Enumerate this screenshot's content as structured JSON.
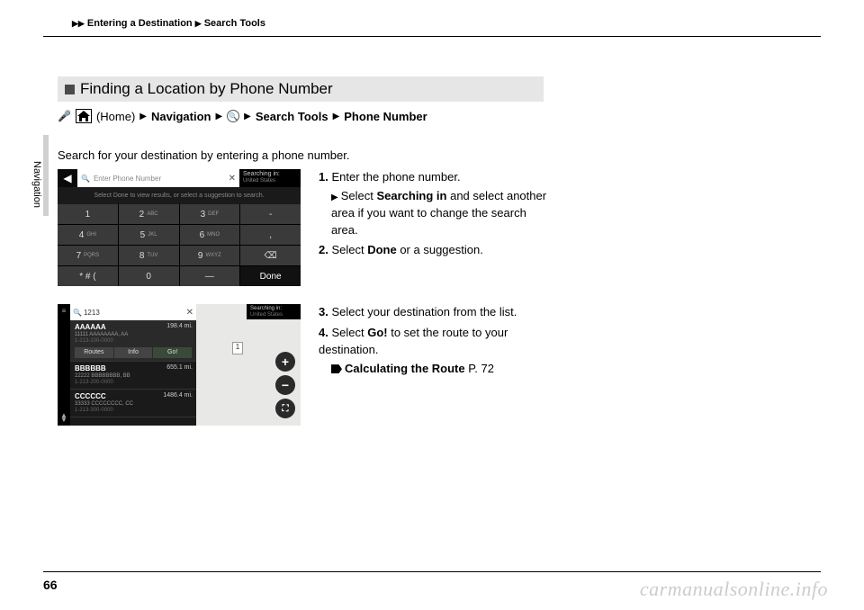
{
  "header": {
    "crumb1": "Entering a Destination",
    "crumb2": "Search Tools"
  },
  "sideTab": "Navigation",
  "title": "Finding a Location by Phone Number",
  "breadcrumb": {
    "home": "(Home)",
    "nav": "Navigation",
    "tools": "Search Tools",
    "phone": "Phone Number"
  },
  "intro": "Search for your destination by entering a phone number.",
  "keypad": {
    "placeholder": "Enter Phone Number",
    "searchInLabel": "Searching in:",
    "searchInValue": "United States",
    "hint": "Select Done to view results, or select a suggestion to search.",
    "keys": [
      {
        "n": "1",
        "s": ""
      },
      {
        "n": "2",
        "s": "ABC"
      },
      {
        "n": "3",
        "s": "DEF"
      },
      {
        "n": "-",
        "s": ""
      },
      {
        "n": "4",
        "s": "GHI"
      },
      {
        "n": "5",
        "s": "JKL"
      },
      {
        "n": "6",
        "s": "MNO"
      },
      {
        "n": ",",
        "s": ""
      },
      {
        "n": "7",
        "s": "PQRS"
      },
      {
        "n": "8",
        "s": "TUV"
      },
      {
        "n": "9",
        "s": "WXYZ"
      },
      {
        "n": "⌫",
        "s": ""
      },
      {
        "n": "* # (",
        "s": ""
      },
      {
        "n": "0",
        "s": ""
      },
      {
        "n": "—",
        "s": ""
      },
      {
        "n": "Done",
        "s": ""
      }
    ]
  },
  "steps1": {
    "s1": "Enter the phone number.",
    "s1a_pre": "Select ",
    "s1a_bold": "Searching in",
    "s1a_post": " and select another area if you want to change the search area.",
    "s2_pre": "Select ",
    "s2_bold": "Done",
    "s2_post": " or a suggestion."
  },
  "results": {
    "query": "1213",
    "searchInLabel": "Searching in:",
    "searchInValue": "United States",
    "items": [
      {
        "name": "AAAAAA",
        "addr": "11111 AAAAAAAA, AA",
        "phone": "1-213-100-0000",
        "dist": "198.4 mi."
      },
      {
        "name": "BBBBBB",
        "addr": "22222 BBBBBBBB, BB",
        "phone": "1-213-200-0000",
        "dist": "655.1 mi."
      },
      {
        "name": "CCCCCC",
        "addr": "33333 CCCCCCCC, CC",
        "phone": "1-213-300-0000",
        "dist": "1486.4 mi."
      }
    ],
    "btns": {
      "routes": "Routes",
      "info": "Info",
      "go": "Go!"
    },
    "pin": "1"
  },
  "steps2": {
    "s3": "Select your destination from the list.",
    "s4_pre": "Select ",
    "s4_bold": "Go!",
    "s4_post": " to set the route to your destination.",
    "ref": "Calculating the Route",
    "refPage": "P. 72"
  },
  "pageNum": "66",
  "watermark": "carmanualsonline.info"
}
